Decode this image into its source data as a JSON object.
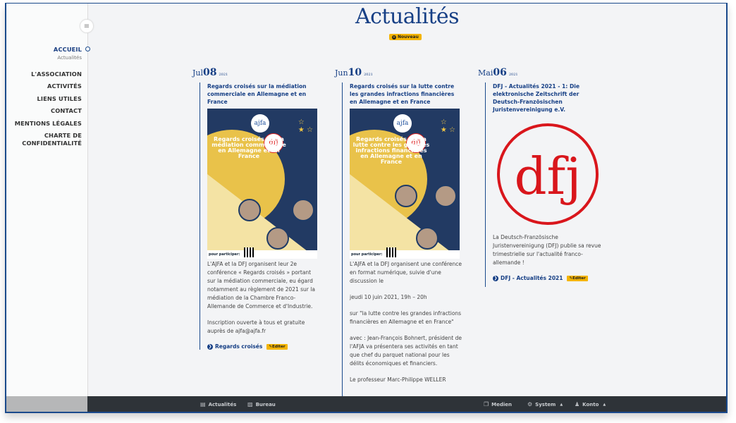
{
  "sidebar": {
    "toggle_icon": "hamburger-icon",
    "items": [
      {
        "label": "ACCUEIL",
        "active": true,
        "sub": "Actualités"
      },
      {
        "label": "L'ASSOCIATION"
      },
      {
        "label": "ACTIVITÉS"
      },
      {
        "label": "LIENS UTILES"
      },
      {
        "label": "CONTACT"
      },
      {
        "label": "MENTIONS LÉGALES"
      },
      {
        "label": "CHARTE DE CONFIDENTIALITÉ"
      }
    ]
  },
  "page": {
    "title": "Actualités",
    "new_button": "Nouveau"
  },
  "posts": [
    {
      "month": "Jul",
      "day": "08",
      "year": "2021",
      "title": "Regards croisés sur la médiation commerciale en Allemagne et en France",
      "image_alt": "Affiche conférence Regards croisés sur la médiation commerciale en Allemagne et en France",
      "poster_title": "Regards croisés sur la médiation commerciale en Allemagne et en France",
      "poster_footer": "pour participer:",
      "paragraphs": [
        "L'AJFA et la DFJ organisent leur 2e conférence « Regards croisés » portant sur la médiation commerciale, eu égard notamment au règlement de 2021 sur la médiation de la Chambre Franco-Allemande de Commerce et d'Industrie.",
        "Inscription ouverte à tous et gratuite auprès de ajfa@ajfa.fr"
      ],
      "link": "Regards croisés",
      "edit": "Editer"
    },
    {
      "month": "Jun",
      "day": "10",
      "year": "2021",
      "title": "Regards croisés sur la lutte contre les grandes infractions financières en Allemagne et en France",
      "image_alt": "Affiche conférence Regards croisés sur la lutte contre les grandes infractions financières",
      "poster_title": "Regards croisés sur la lutte contre les grandes infractions financières en Allemagne et en France",
      "poster_footer": "pour participer:",
      "paragraphs": [
        "L'AJFA et la DFJ organisent une conférence en format numérique, suivie d'une discussion le",
        "jeudi 10 juin 2021, 19h – 20h",
        "sur \"la lutte contre les grandes infractions financières en Allemagne et en France\"",
        "avec : Jean-François Bohnert, président de l'AFJA va présentera ses activités en tant que chef du parquet national pour les délits économiques et financiers.",
        "Le professeur Marc-Philippe WELLER"
      ]
    },
    {
      "month": "Mai",
      "day": "06",
      "year": "2021",
      "title": "DFJ - Actualités 2021 - 1: Die elektronische Zeitschrift der Deutsch-Französischen Juristenvereinigung e.V.",
      "image_alt": "Logo dfj",
      "paragraphs": [
        "La Deutsch-Französische Juristenvereinigung (DFJ) publie sa revue trimestrielle sur l'actualité franco-allemande !"
      ],
      "link": "DFJ - Actualités 2021",
      "edit": "Editer"
    }
  ],
  "bottombar": {
    "left": [
      {
        "label": "Actualités",
        "icon": "newspaper-icon"
      },
      {
        "label": "Bureau",
        "icon": "desk-icon"
      }
    ],
    "right": [
      {
        "label": "Medien",
        "icon": "media-icon"
      },
      {
        "label": "System",
        "icon": "gear-icon",
        "dropdown": true
      },
      {
        "label": "Konto",
        "icon": "user-icon",
        "dropdown": true
      }
    ]
  },
  "colors": {
    "brand_blue": "#163f85",
    "accent_yellow": "#f4b400",
    "bar_dark": "#2e3338",
    "dfj_red": "#d9161c"
  }
}
